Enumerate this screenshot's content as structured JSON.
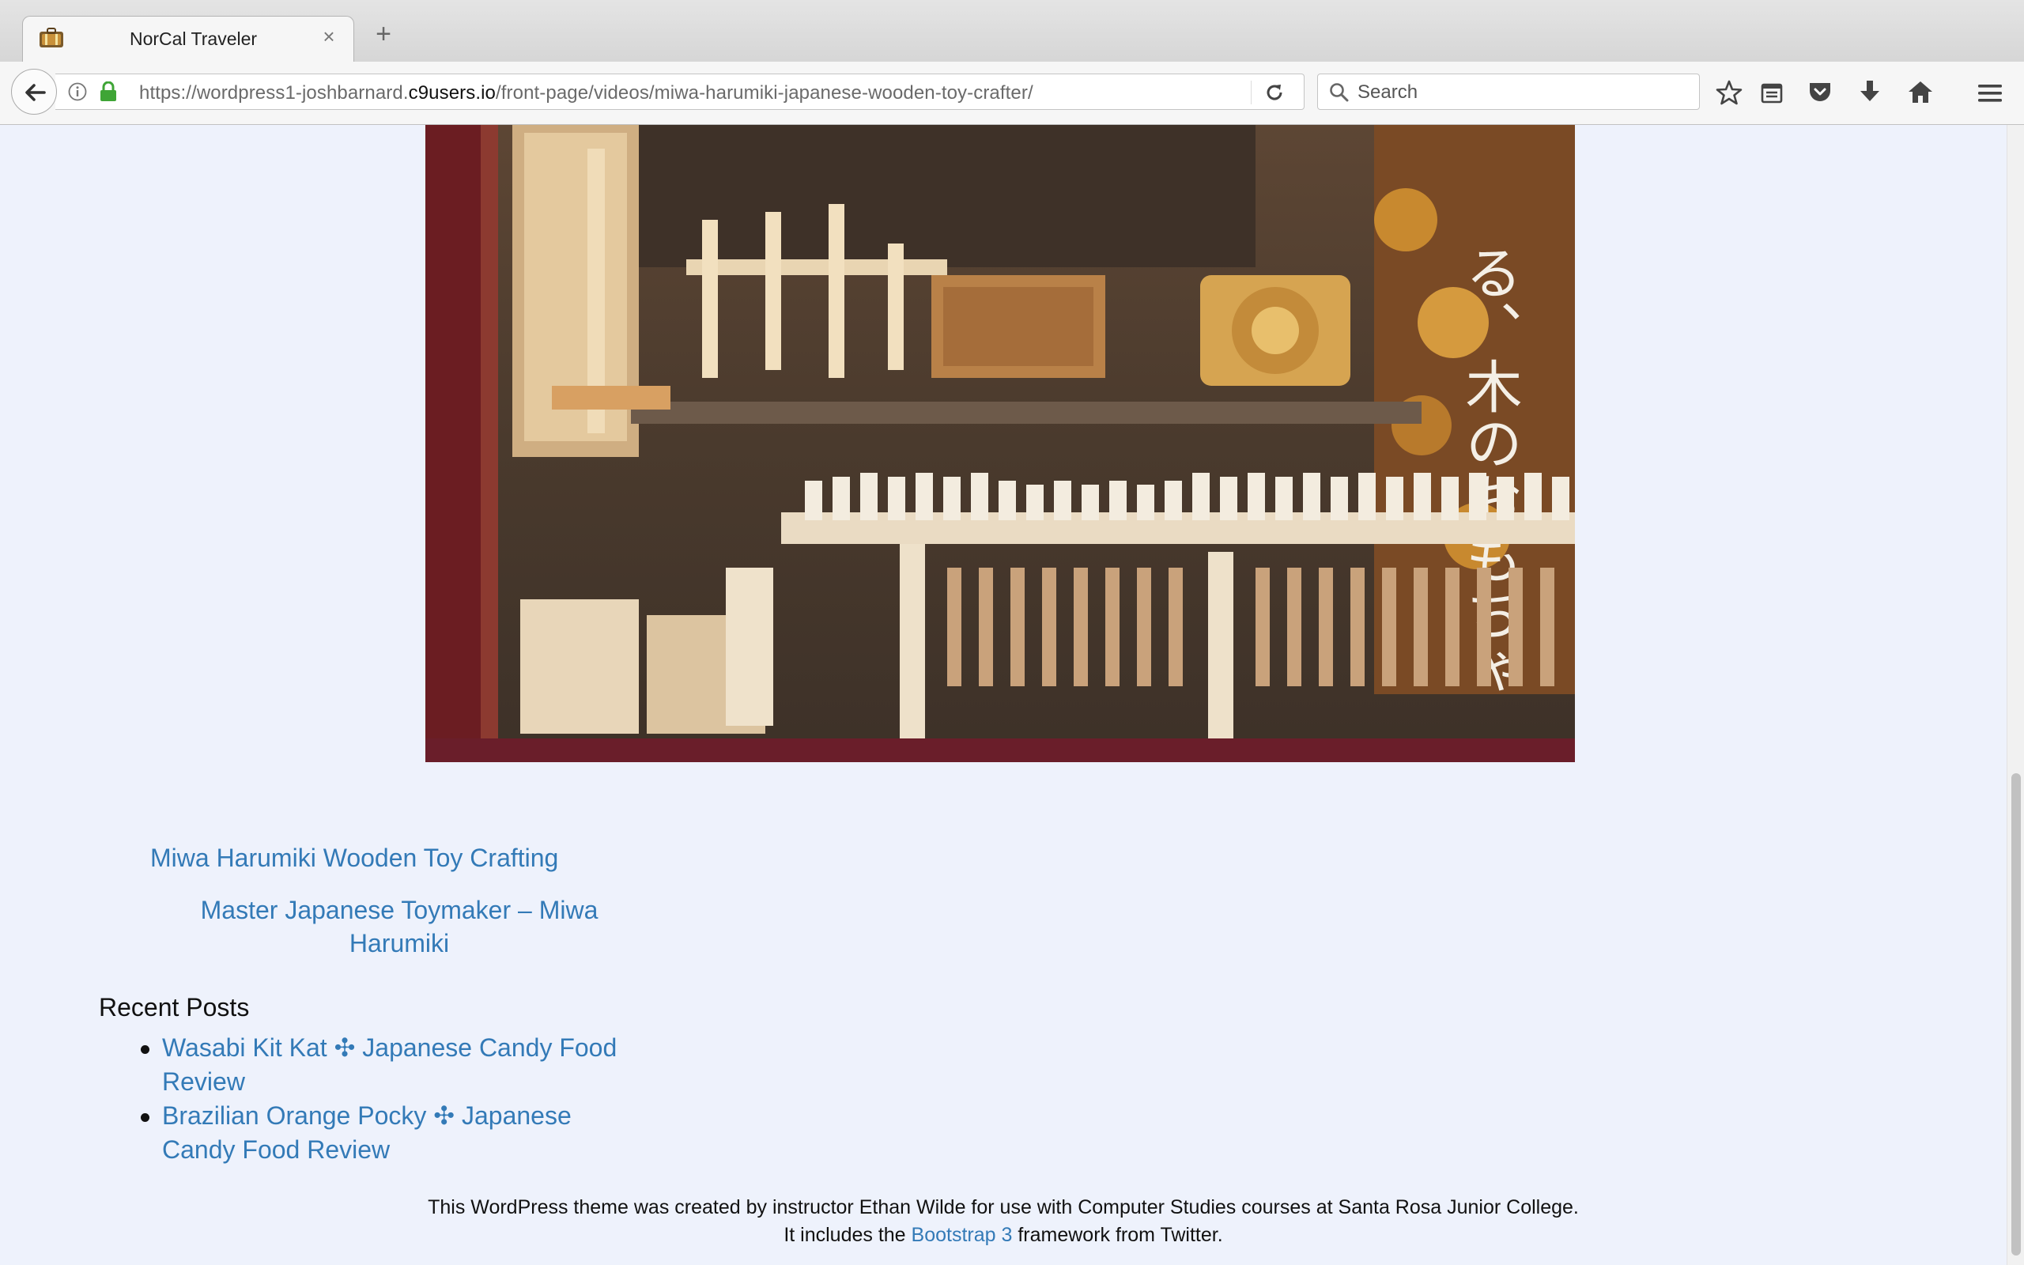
{
  "browser": {
    "tab_title": "NorCal Traveler",
    "tab_close": "×",
    "new_tab": "+",
    "url_prefix": "https://wordpress1-joshbarnard.",
    "url_domain": "c9users.io",
    "url_path": "/front-page/videos/miwa-harumiki-japanese-wooden-toy-crafter/",
    "search_placeholder": "Search"
  },
  "content": {
    "hero_image_alt": "Miwa Harumiki wooden toy display",
    "related_links": [
      "Miwa Harumiki Wooden Toy Crafting",
      "Master Japanese Toymaker – Miwa Harumiki"
    ],
    "recent_posts_title": "Recent Posts",
    "recent_posts": [
      "Wasabi Kit Kat ✣ Japanese Candy Food Review",
      "Brazilian Orange Pocky ✣ Japanese Candy Food Review"
    ]
  },
  "footer": {
    "line1": "This WordPress theme was created by instructor Ethan Wilde for use with Computer Studies courses at Santa Rosa Junior College.",
    "line2_before": "It includes the ",
    "line2_link": "Bootstrap 3",
    "line2_after": " framework from Twitter."
  },
  "colors": {
    "link": "#337ab7",
    "page_background": "#eef2fc"
  }
}
